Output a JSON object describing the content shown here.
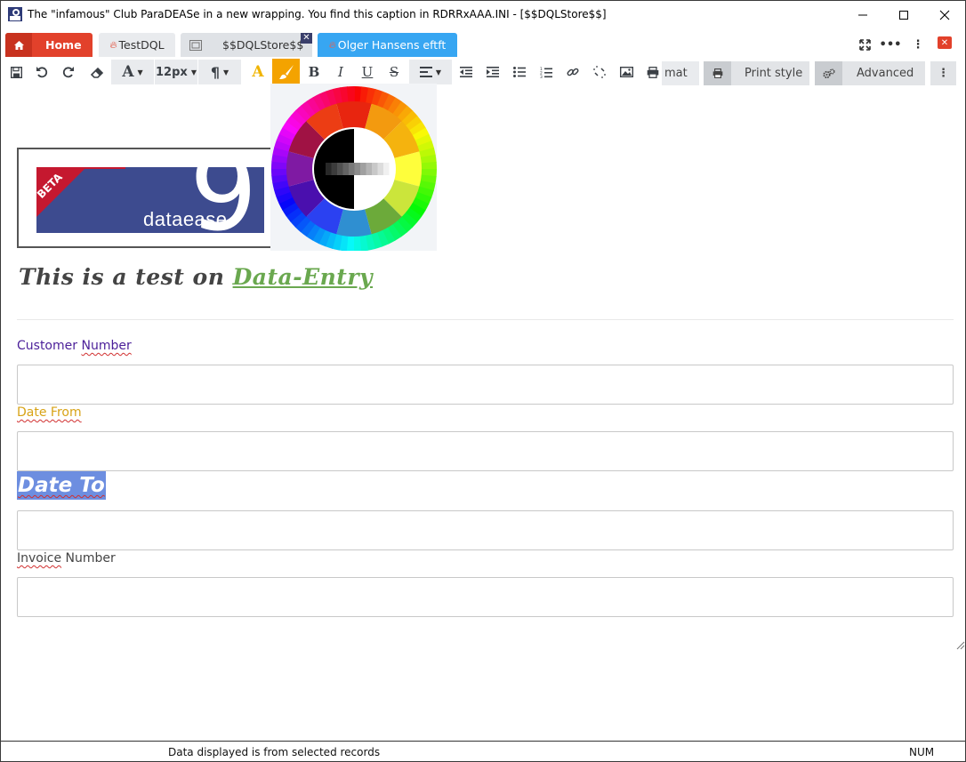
{
  "window": {
    "title": "The \"infamous\" Club ParaDEASe in a new wrapping. You find this caption in RDRRxAAA.INI - [$$DQLStore$$]"
  },
  "tabs": [
    {
      "label": "Home",
      "icon": "home-icon"
    },
    {
      "label": "TestDQL",
      "icon": "fire-icon"
    },
    {
      "label": "$$DQLStore$$",
      "icon": "image-icon"
    },
    {
      "label": "Olger Hansens eftft",
      "icon": "fire-icon"
    }
  ],
  "toolbar": {
    "font_size": "12px",
    "bold": "B",
    "italic": "I",
    "underline": "U",
    "strike": "S",
    "format_partial": "mat",
    "print_style": "Print style",
    "advanced": "Advanced"
  },
  "colors": {
    "home_tab": "#e2412b",
    "active_tab": "#37a6f2",
    "heading_accent": "#6aa84f",
    "selection": "#6d8ee0"
  },
  "content": {
    "logo": {
      "ribbon": "BETA",
      "text": "dataease"
    },
    "heading_prefix": "This is a test on ",
    "heading_accent": "Data-Entry",
    "fields": [
      {
        "label_a": "Customer ",
        "label_b": "Number",
        "color": "#4b1f99"
      },
      {
        "label_a": "Date From",
        "label_b": "",
        "color": "#d8a317"
      },
      {
        "label_a": "Date To",
        "label_b": "",
        "color": "#ffffff"
      },
      {
        "label_a": "Invoice",
        "label_b": " Number",
        "color": "#444444"
      }
    ]
  },
  "status": {
    "message": "Data displayed is from selected records",
    "num": "NUM"
  }
}
